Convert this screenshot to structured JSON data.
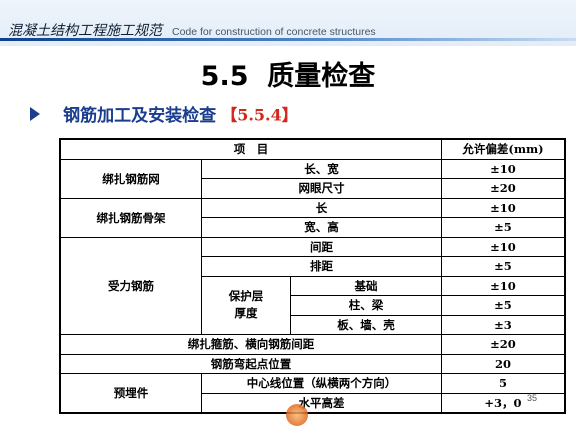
{
  "header": {
    "title_cn": "混凝土结构工程施工规范",
    "title_en": "Code for construction of concrete structures"
  },
  "title": "5.5  质量检查",
  "bullet": {
    "text": "钢筋加工及安装检查",
    "ref": "【5.5.4】"
  },
  "table": {
    "header": {
      "item": "项　目",
      "tolerance": "允许偏差(mm)"
    },
    "rows": {
      "r1": {
        "group": "绑扎钢筋网",
        "item": "长、宽",
        "value": "±10"
      },
      "r2": {
        "item": "网眼尺寸",
        "value": "±20"
      },
      "r3": {
        "group": "绑扎钢筋骨架",
        "item": "长",
        "value": "±10"
      },
      "r4": {
        "item": "宽、高",
        "value": "±5"
      },
      "r5": {
        "group": "受力钢筋",
        "item": "间距",
        "value": "±10"
      },
      "r6": {
        "item": "排距",
        "value": "±5"
      },
      "r7": {
        "subgroup": "保护层\n厚度",
        "item": "基础",
        "value": "±10"
      },
      "r8": {
        "item": "柱、梁",
        "value": "±5"
      },
      "r9": {
        "item": "板、墙、壳",
        "value": "±3"
      },
      "r10": {
        "item": "绑扎箍筋、横向钢筋间距",
        "value": "±20"
      },
      "r11": {
        "item": "钢筋弯起点位置",
        "value": "20"
      },
      "r12": {
        "group": "预埋件",
        "item": "中心线位置（纵横两个方向）",
        "value": "5"
      },
      "r13": {
        "item": "水平高差",
        "value": "+3，0"
      }
    }
  },
  "page_number": "35"
}
